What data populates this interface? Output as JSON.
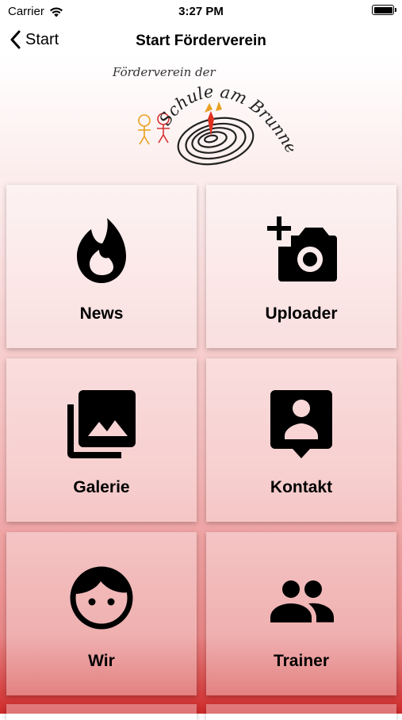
{
  "status_bar": {
    "carrier": "Carrier",
    "time": "3:27 PM",
    "icons": [
      "wifi-icon",
      "battery-icon"
    ]
  },
  "nav": {
    "back_label": "Start",
    "title": "Start Förderverein",
    "back_icon": "chevron-left-icon"
  },
  "logo": {
    "top_text": "Förderverein der",
    "main_text": "Schule am Brunnen",
    "colors": {
      "kids": "#e8a020",
      "kid_red": "#d83030",
      "splash": "#e03020",
      "ink": "#222222"
    }
  },
  "tiles": [
    {
      "label": "News",
      "icon": "flame-icon"
    },
    {
      "label": "Uploader",
      "icon": "add-photo-icon"
    },
    {
      "label": "Galerie",
      "icon": "photo-library-icon"
    },
    {
      "label": "Kontakt",
      "icon": "contact-card-icon"
    },
    {
      "label": "Wir",
      "icon": "face-icon"
    },
    {
      "label": "Trainer",
      "icon": "group-icon"
    }
  ],
  "colors": {
    "background_top": "#ffffff",
    "background_bottom": "#cf2a2a",
    "icon": "#000000"
  }
}
